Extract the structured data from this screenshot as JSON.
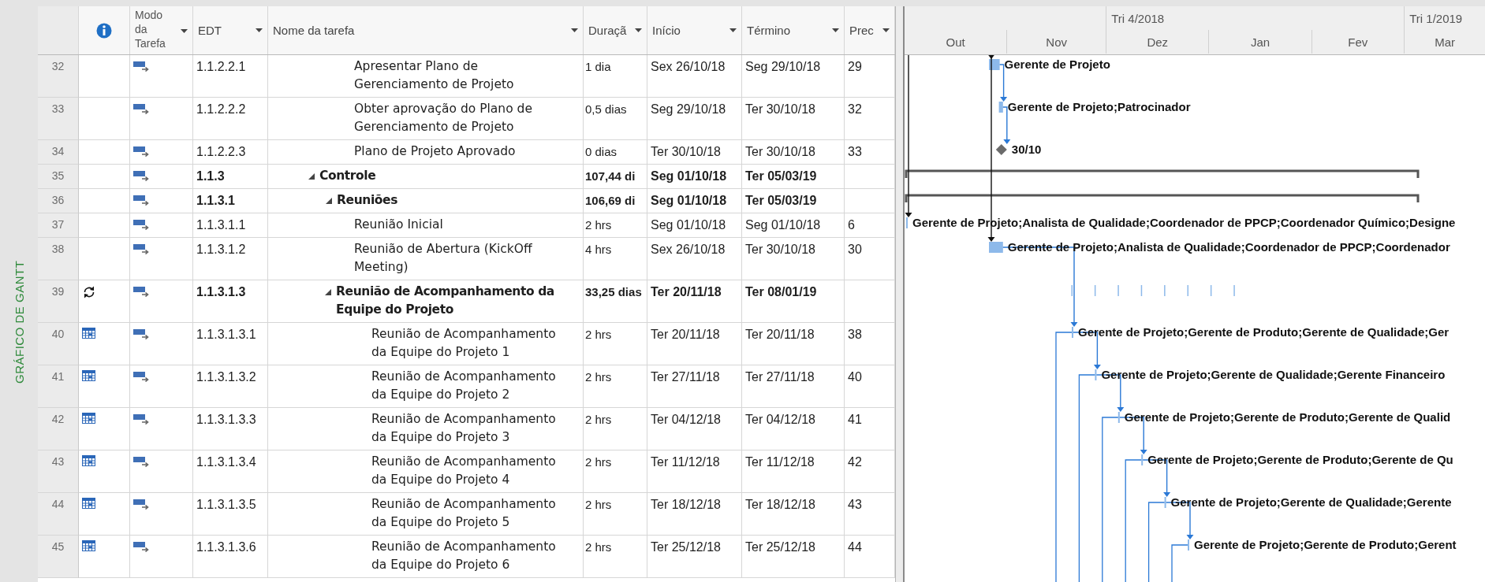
{
  "view_label": "GRÁFICO DE GANTT",
  "columns": [
    {
      "kind": "indicators",
      "dropdown": false
    },
    {
      "kind": "mode",
      "label": "Modo da Tarefa",
      "dropdown": true
    },
    {
      "kind": "wbs",
      "label": "EDT",
      "dropdown": true
    },
    {
      "kind": "name",
      "label": "Nome da tarefa",
      "dropdown": true
    },
    {
      "kind": "duration",
      "label": "Duraçã",
      "dropdown": true
    },
    {
      "kind": "start",
      "label": "Início",
      "dropdown": true
    },
    {
      "kind": "finish",
      "label": "Término",
      "dropdown": true
    },
    {
      "kind": "predecessors",
      "label": "Prec",
      "dropdown": true
    }
  ],
  "rows": [
    {
      "id": "32",
      "wbs": "1.1.2.2.1",
      "name": "Apresentar Plano de Gerenciamento de Projeto",
      "duration": "1 dia",
      "start": "Sex 26/10/18",
      "finish": "Seg 29/10/18",
      "predecessors": "29",
      "summary": false,
      "bar": {
        "kind": "task",
        "label": "Gerente de Projeto"
      }
    },
    {
      "id": "33",
      "wbs": "1.1.2.2.2",
      "name": "Obter aprovação do Plano de Gerenciamento de Projeto",
      "duration": "0,5 dias",
      "start": "Seg 29/10/18",
      "finish": "Ter 30/10/18",
      "predecessors": "32",
      "summary": false,
      "bar": {
        "kind": "task",
        "label": "Gerente de Projeto;Patrocinador"
      }
    },
    {
      "id": "34",
      "wbs": "1.1.2.2.3",
      "name": "Plano de Projeto Aprovado",
      "duration": "0 dias",
      "start": "Ter 30/10/18",
      "finish": "Ter 30/10/18",
      "predecessors": "33",
      "summary": false,
      "bar": {
        "kind": "milestone",
        "label": "30/10"
      }
    },
    {
      "id": "35",
      "wbs": "1.1.3",
      "name": "Controle",
      "duration": "107,44 di",
      "start": "Seg 01/10/18",
      "finish": "Ter 05/03/19",
      "summary": true,
      "expanded": true,
      "bar": {
        "kind": "summary"
      },
      "children": [
        {
          "id": "36",
          "wbs": "1.1.3.1",
          "name": "Reuniões",
          "duration": "106,69 di",
          "start": "Seg 01/10/18",
          "finish": "Ter 05/03/19",
          "summary": true,
          "expanded": true,
          "bar": {
            "kind": "summary"
          },
          "children": [
            {
              "id": "37",
              "wbs": "1.1.3.1.1",
              "name": "Reunião Inicial",
              "duration": "2 hrs",
              "start": "Seg 01/10/18",
              "finish": "Seg 01/10/18",
              "predecessors": "6",
              "summary": false,
              "bar": {
                "kind": "task",
                "label": "Gerente de Projeto;Analista de Qualidade;Coordenador de PPCP;Coordenador Químico;Designe"
              }
            },
            {
              "id": "38",
              "wbs": "1.1.3.1.2",
              "name": "Reunião de Abertura (KickOff Meeting)",
              "duration": "4 hrs",
              "start": "Sex 26/10/18",
              "finish": "Ter 30/10/18",
              "predecessors": "30",
              "summary": false,
              "bar": {
                "kind": "task",
                "label": "Gerente de Projeto;Analista de Qualidade;Coordenador de PPCP;Coordenador"
              }
            },
            {
              "id": "39",
              "indicator": {
                "kind": "recurring"
              },
              "wbs": "1.1.3.1.3",
              "name": "Reunião de Acompanhamento da Equipe do Projeto",
              "duration": "33,25 dias",
              "start": "Ter 20/11/18",
              "finish": "Ter 08/01/19",
              "summary": true,
              "expanded": true,
              "bar": {
                "kind": "recurring"
              },
              "children": [
                {
                  "id": "40",
                  "indicator": {
                    "kind": "calendar"
                  },
                  "wbs": "1.1.3.1.3.1",
                  "name": "Reunião de Acompanhamento da Equipe do Projeto 1",
                  "duration": "2 hrs",
                  "start": "Ter 20/11/18",
                  "finish": "Ter 20/11/18",
                  "predecessors": "38",
                  "summary": false,
                  "bar": {
                    "kind": "task",
                    "label": "Gerente de Projeto;Gerente de Produto;Gerente de Qualidade;Ger"
                  }
                },
                {
                  "id": "41",
                  "indicator": {
                    "kind": "calendar"
                  },
                  "wbs": "1.1.3.1.3.2",
                  "name": "Reunião de Acompanhamento da Equipe do Projeto 2",
                  "duration": "2 hrs",
                  "start": "Ter 27/11/18",
                  "finish": "Ter 27/11/18",
                  "predecessors": "40",
                  "summary": false,
                  "bar": {
                    "kind": "task",
                    "label": "Gerente de Projeto;Gerente de Qualidade;Gerente Financeiro"
                  }
                },
                {
                  "id": "42",
                  "indicator": {
                    "kind": "calendar"
                  },
                  "wbs": "1.1.3.1.3.3",
                  "name": "Reunião de Acompanhamento da Equipe do Projeto 3",
                  "duration": "2 hrs",
                  "start": "Ter 04/12/18",
                  "finish": "Ter 04/12/18",
                  "predecessors": "41",
                  "summary": false,
                  "bar": {
                    "kind": "task",
                    "label": "Gerente de Projeto;Gerente de Produto;Gerente de Qualid"
                  }
                },
                {
                  "id": "43",
                  "indicator": {
                    "kind": "calendar"
                  },
                  "wbs": "1.1.3.1.3.4",
                  "name": "Reunião de Acompanhamento da Equipe do Projeto 4",
                  "duration": "2 hrs",
                  "start": "Ter 11/12/18",
                  "finish": "Ter 11/12/18",
                  "predecessors": "42",
                  "summary": false,
                  "bar": {
                    "kind": "task",
                    "label": "Gerente de Projeto;Gerente de Produto;Gerente de Qu"
                  }
                },
                {
                  "id": "44",
                  "indicator": {
                    "kind": "calendar"
                  },
                  "wbs": "1.1.3.1.3.5",
                  "name": "Reunião de Acompanhamento da Equipe do Projeto 5",
                  "duration": "2 hrs",
                  "start": "Ter 18/12/18",
                  "finish": "Ter 18/12/18",
                  "predecessors": "43",
                  "summary": false,
                  "bar": {
                    "kind": "task",
                    "label": "Gerente de Projeto;Gerente de Qualidade;Gerente"
                  }
                },
                {
                  "id": "45",
                  "indicator": {
                    "kind": "calendar"
                  },
                  "wbs": "1.1.3.1.3.6",
                  "name": "Reunião de Acompanhamento da Equipe do Projeto 6",
                  "duration": "2 hrs",
                  "start": "Ter 25/12/18",
                  "finish": "Ter 25/12/18",
                  "predecessors": "44",
                  "summary": false,
                  "bar": {
                    "kind": "task",
                    "label": "Gerente de Projeto;Gerente de Produto;Gerent"
                  }
                }
              ]
            }
          ]
        }
      ]
    }
  ],
  "gantt": {
    "quarters": [
      "Tri 4/2018",
      "Tri 1/2019"
    ],
    "months": [
      "Out",
      "Nov",
      "Dez",
      "Jan",
      "Fev",
      "Mar"
    ]
  }
}
